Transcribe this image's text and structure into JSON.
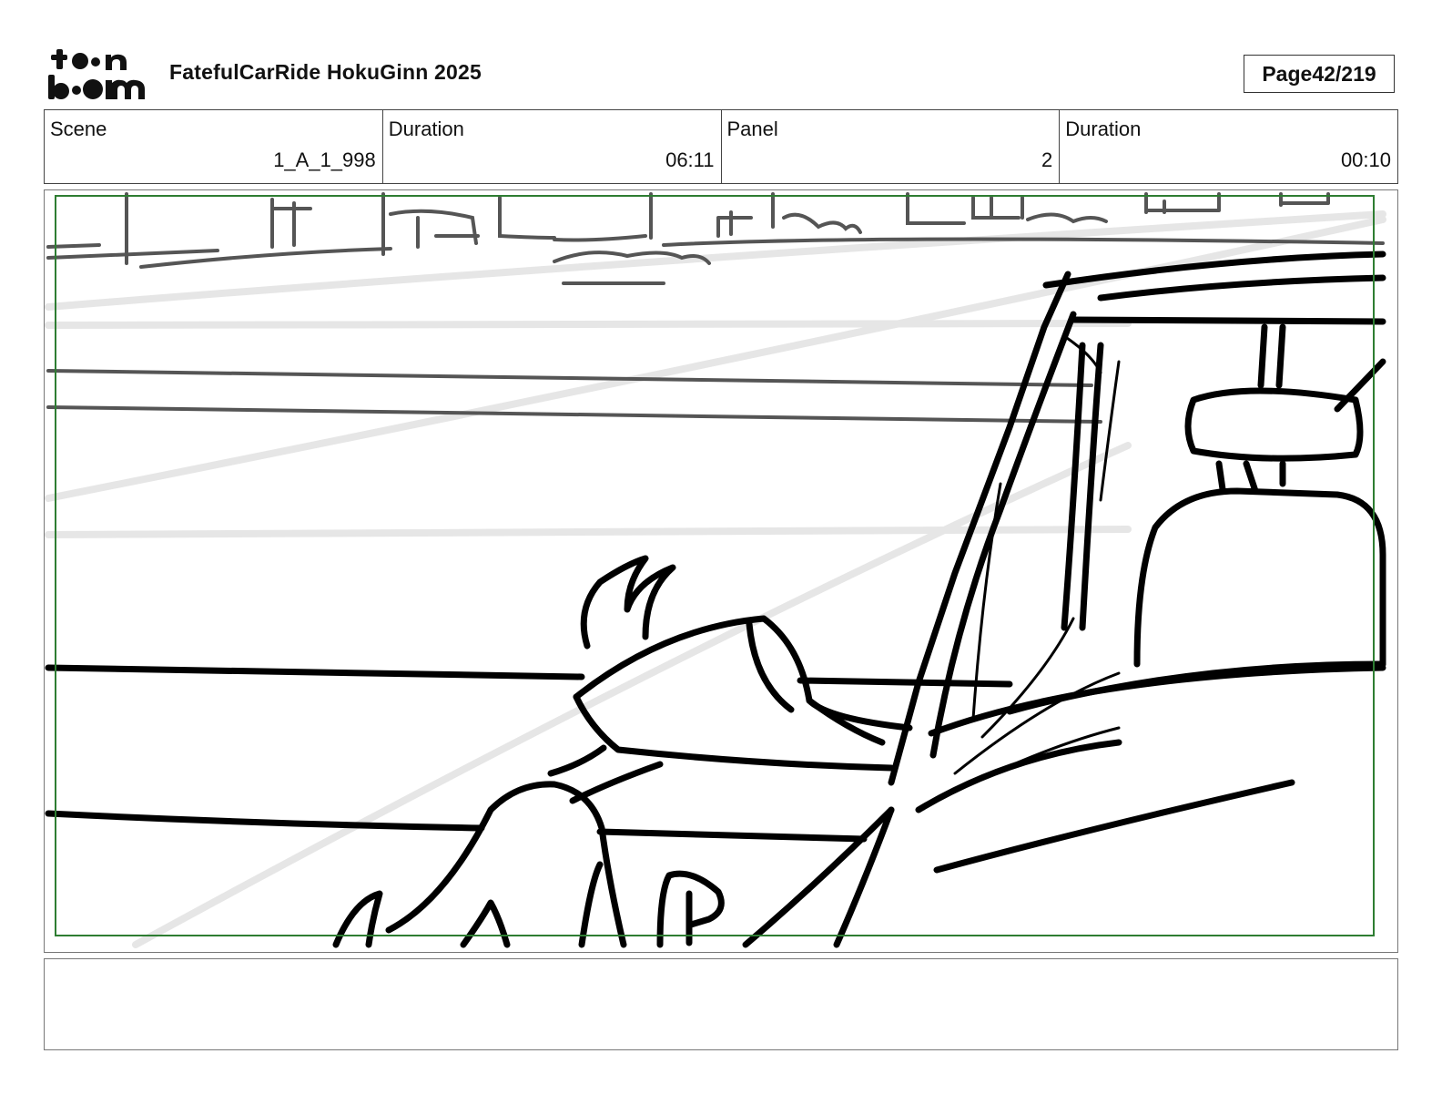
{
  "header": {
    "logo_text": "toon boom",
    "project_title": "FatefulCarRide HokuGinn 2025",
    "page_label": "Page",
    "page_number": "42/219"
  },
  "info": {
    "scene_label": "Scene",
    "scene_value": "1_A_1_998",
    "scene_duration_label": "Duration",
    "scene_duration_value": "06:11",
    "panel_label": "Panel",
    "panel_value": "2",
    "panel_duration_label": "Duration",
    "panel_duration_value": "00:10"
  },
  "panel": {
    "safe_frame_color": "#2e7d32",
    "ink_color": "#000000",
    "grey_ink_color": "#555555",
    "light_ink_color": "#e6e6e6"
  },
  "notes": {
    "text": ""
  }
}
